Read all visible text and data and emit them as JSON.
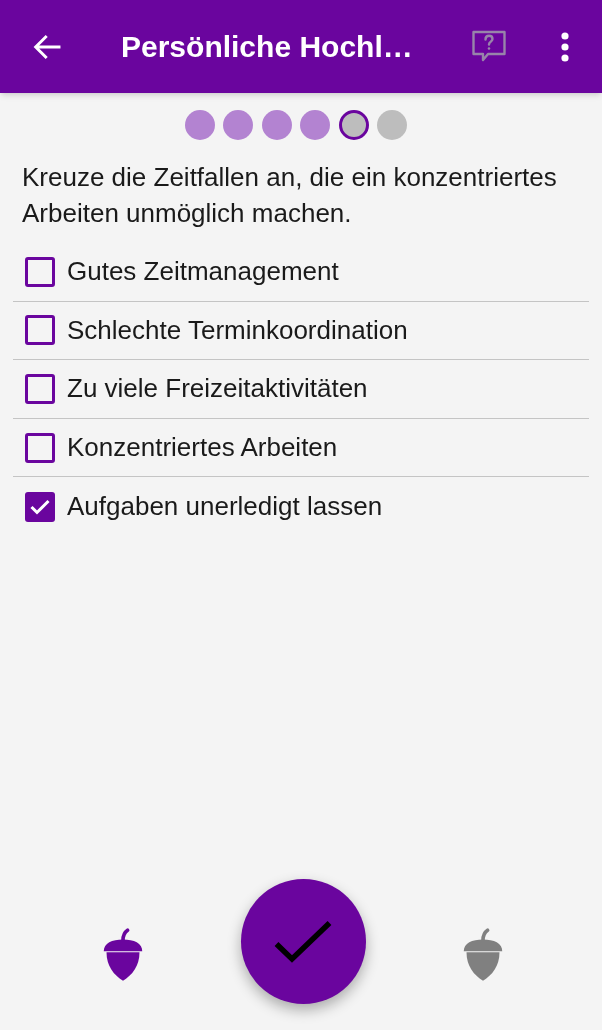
{
  "app_bar": {
    "title": "Persönliche Hochl…",
    "help_button": {
      "disabled": true
    }
  },
  "progress": {
    "steps": [
      {
        "completed": true,
        "selected": false
      },
      {
        "completed": true,
        "selected": false
      },
      {
        "completed": true,
        "selected": false
      },
      {
        "completed": true,
        "selected": false
      },
      {
        "completed": false,
        "selected": true
      },
      {
        "completed": false,
        "selected": false
      }
    ]
  },
  "instruction": "Kreuze die Zeitfallen an, die ein konzentriertes Arbeiten unmöglich machen.",
  "options": [
    {
      "label": "Gutes Zeitmanagement",
      "checked": false
    },
    {
      "label": "Schlechte Terminkoordination",
      "checked": false
    },
    {
      "label": "Zu viele Freizeitaktivitäten",
      "checked": false
    },
    {
      "label": "Konzentriertes Arbeiten",
      "checked": false
    },
    {
      "label": "Aufgaben unerledigt lassen",
      "checked": true
    }
  ],
  "navigation": {
    "previous": {
      "disabled": false
    },
    "next": {
      "disabled": true
    }
  }
}
